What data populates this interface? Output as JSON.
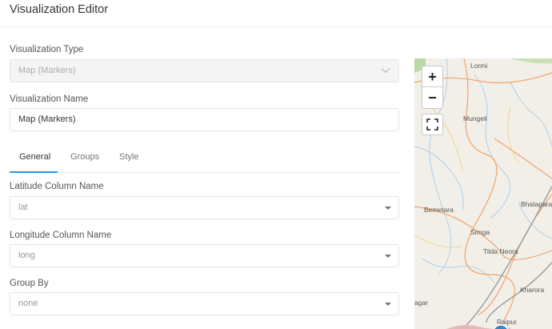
{
  "header": {
    "title": "Visualization Editor"
  },
  "form": {
    "type_label": "Visualization Type",
    "type_value": "Map (Markers)",
    "name_label": "Visualization Name",
    "name_value": "Map (Markers)"
  },
  "tabs": [
    {
      "label": "General",
      "active": true
    },
    {
      "label": "Groups",
      "active": false
    },
    {
      "label": "Style",
      "active": false
    }
  ],
  "general": {
    "latitude_label": "Latitude Column Name",
    "latitude_value": "lat",
    "longitude_label": "Longitude Column Name",
    "longitude_value": "long",
    "group_label": "Group By",
    "group_value": "none"
  },
  "map": {
    "zoom_in": "+",
    "zoom_out": "−",
    "places": [
      "Lormi",
      "Mungeli",
      "Bemetara",
      "Bhatapara",
      "Simga",
      "Tilda Neora",
      "Kharora",
      "agar",
      "Raipur"
    ]
  },
  "colors": {
    "accent": "#2196f3",
    "marker": "#3d82c4",
    "road": "#f2a468",
    "river": "#a9cce8"
  }
}
